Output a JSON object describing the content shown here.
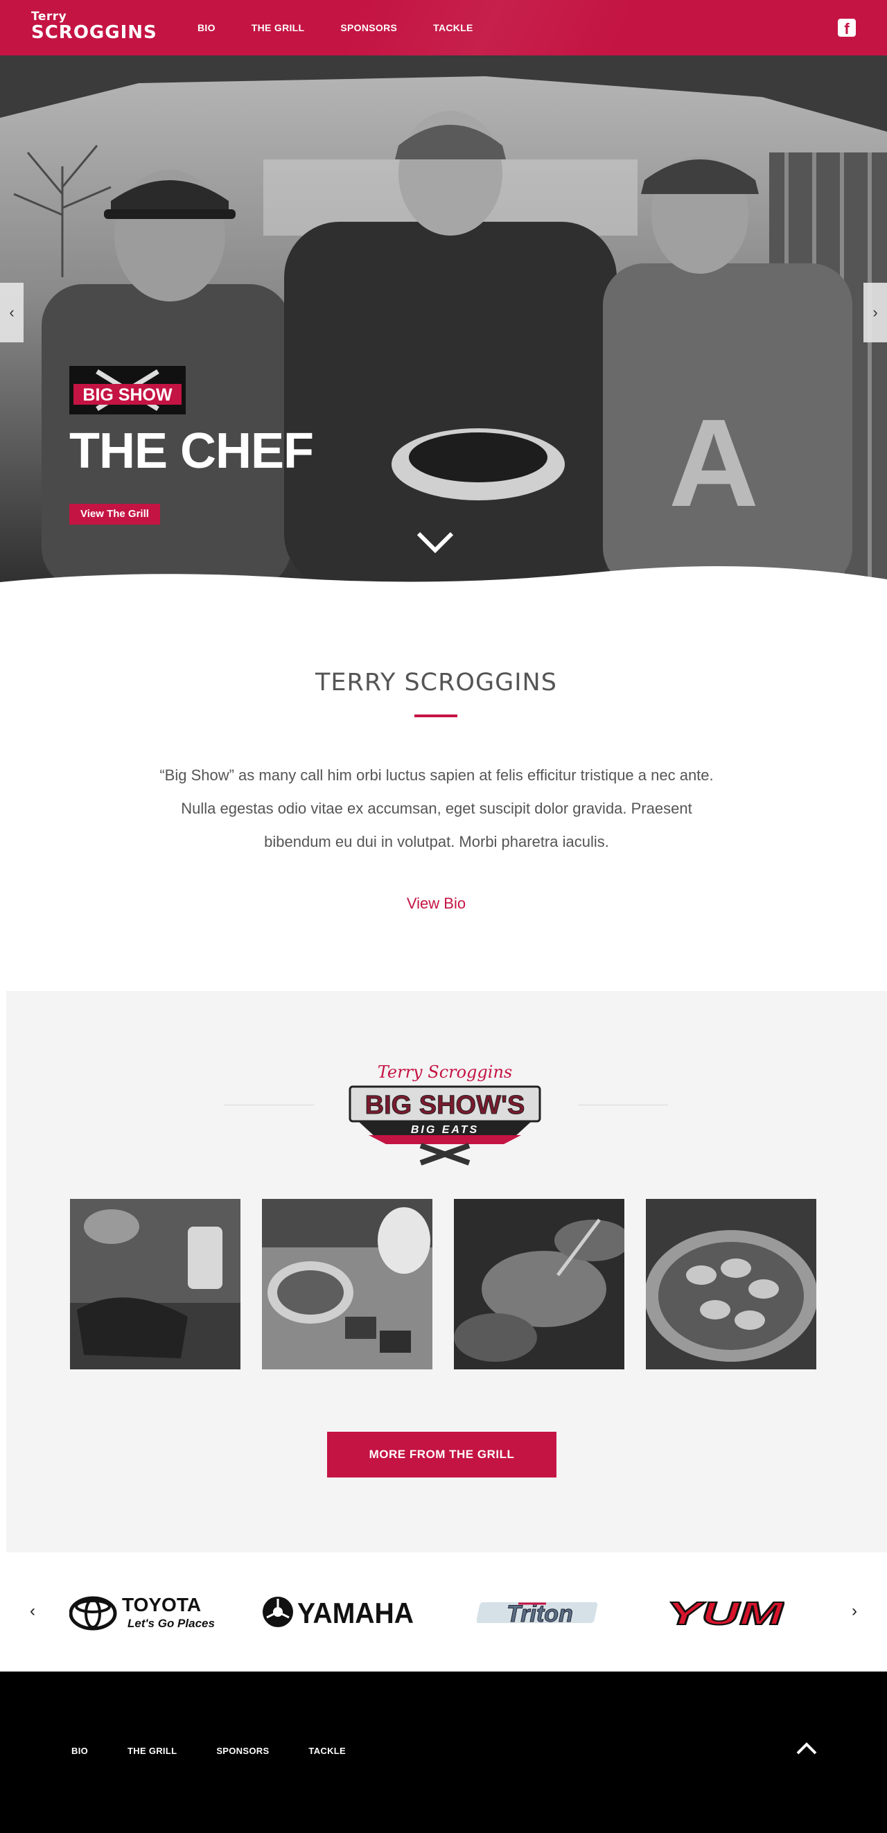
{
  "header": {
    "logo_line1": "Terry",
    "logo_line2": "SCROGGINS",
    "nav": [
      "BIO",
      "THE GRILL",
      "SPONSORS",
      "TACKLE"
    ],
    "facebook_glyph": "f"
  },
  "hero": {
    "badge_text": "BIG SHOW",
    "title": "THE CHEF",
    "button": "View The Grill",
    "prev_glyph": "‹",
    "next_glyph": "›"
  },
  "bio": {
    "title": "TERRY SCROGGINS",
    "text": "“Big Show” as many call him orbi luctus sapien at felis efficitur tristique a nec ante. Nulla egestas odio vitae ex accumsan, eget suscipit dolor gravida. Praesent bibendum eu dui in volutpat. Morbi pharetra iaculis.",
    "link": "View Bio"
  },
  "grill": {
    "logo_script": "Terry Scroggins",
    "logo_main": "BIG SHOW'S",
    "logo_sub": "BIG EATS",
    "photos": [
      "ribs-photo",
      "dessert-photo",
      "steak-photo",
      "bacon-wraps-photo"
    ],
    "button": "MORE FROM THE GRILL"
  },
  "sponsors": {
    "prev_glyph": "‹",
    "next_glyph": "›",
    "toyota": "TOYOTA",
    "toyota_tag": "Let's Go Places",
    "yamaha": "YAMAHA",
    "triton": "Triton",
    "yum": "YUM"
  },
  "footer": {
    "nav": [
      "BIO",
      "THE GRILL",
      "SPONSORS",
      "TACKLE"
    ]
  },
  "colors": {
    "brand": "#c41443",
    "footer": "#000000",
    "grill_bg": "#f4f4f4"
  }
}
